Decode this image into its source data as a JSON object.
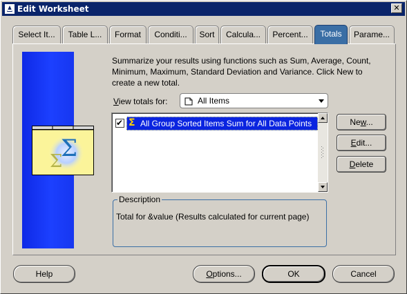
{
  "window": {
    "title": "Edit Worksheet",
    "close_glyph": "✕"
  },
  "tabs": [
    {
      "label": "Select It...",
      "active": false
    },
    {
      "label": "Table L...",
      "active": false
    },
    {
      "label": "Format",
      "active": false
    },
    {
      "label": "Conditi...",
      "active": false
    },
    {
      "label": "Sort",
      "active": false
    },
    {
      "label": "Calcula...",
      "active": false
    },
    {
      "label": "Percent...",
      "active": false
    },
    {
      "label": "Totals",
      "active": true
    },
    {
      "label": "Parame...",
      "active": false
    }
  ],
  "totals_page": {
    "summary_line1": "Summarize your results using functions such as Sum, Average, Count,",
    "summary_line2": "Minimum, Maximum, Standard Deviation and Variance.  Click New to",
    "summary_line3": "create a new total.",
    "view_label_mnemonic": "V",
    "view_label_rest": "iew totals for:",
    "view_selected": "All Items",
    "list_items": [
      {
        "label": "All Group Sorted Items Sum for All Data Points",
        "checked": true,
        "selected": true,
        "checkmark": "✔",
        "symbol": "Σ"
      }
    ],
    "buttons": {
      "new_before": "Ne",
      "new_mnemonic": "w",
      "new_after": "...",
      "edit_mnemonic": "E",
      "edit_after": "dit...",
      "delete_mnemonic": "D",
      "delete_after": "elete"
    },
    "description": {
      "legend": "Description",
      "text": "Total for &value (Results calculated for current page)"
    }
  },
  "footer": {
    "help": "Help",
    "options_mnemonic": "O",
    "options_after": "ptions...",
    "ok": "OK",
    "cancel": "Cancel"
  },
  "colors": {
    "titlebar": "#0a246a",
    "active_tab": "#3a6ea5",
    "selection": "#0a24e0",
    "strip": "#1c40ff"
  },
  "icons": {
    "title": "app-icon",
    "combo": "folder-icon",
    "logo": "totals-sigma-icon"
  }
}
